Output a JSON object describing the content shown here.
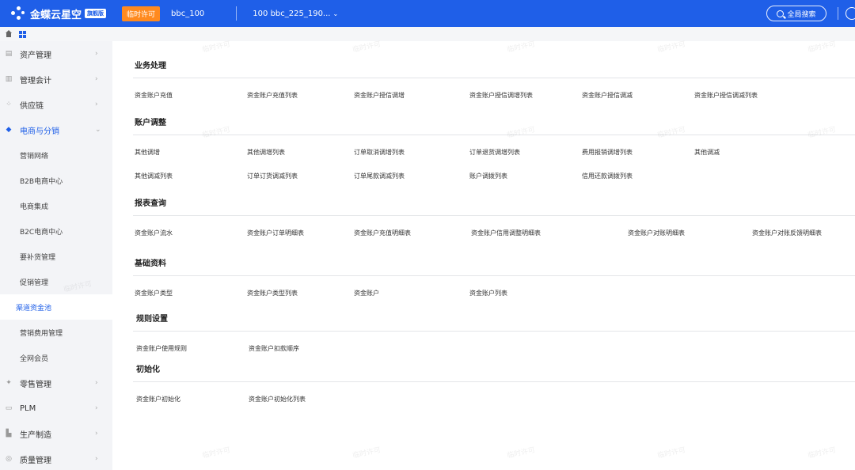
{
  "topbar": {
    "app_name": "金蝶云星空",
    "badge": "旗舰版",
    "license_tag": "临时许可",
    "tenant": "bbc_100",
    "org": "100 bbc_225_190...",
    "search_label": "全局搜索"
  },
  "sidebar": {
    "items": [
      {
        "label": "资产管理",
        "icon": "asset-icon"
      },
      {
        "label": "管理会计",
        "icon": "accounting-icon"
      },
      {
        "label": "供应链",
        "icon": "supply-chain-icon"
      },
      {
        "label": "电商与分销",
        "icon": "ecommerce-icon",
        "open": true
      }
    ],
    "sub_items": [
      {
        "label": "营销网络"
      },
      {
        "label": "B2B电商中心"
      },
      {
        "label": "电商集成"
      },
      {
        "label": "B2C电商中心"
      },
      {
        "label": "要补货管理"
      },
      {
        "label": "促销管理"
      },
      {
        "label": "渠道资金池",
        "active": true
      },
      {
        "label": "营销费用管理"
      },
      {
        "label": "全网会员"
      }
    ],
    "items_after": [
      {
        "label": "零售管理",
        "icon": "retail-icon"
      },
      {
        "label": "PLM",
        "icon": "plm-icon"
      },
      {
        "label": "生产制造",
        "icon": "manufacturing-icon"
      },
      {
        "label": "质量管理",
        "icon": "quality-icon"
      }
    ]
  },
  "sections": [
    {
      "title": "业务处理",
      "rows": [
        [
          "资金账户充值",
          "资金账户充值列表",
          "资金账户授信调增",
          "资金账户授信调增列表",
          "资金账户授信调减",
          "资金账户授信调减列表"
        ]
      ]
    },
    {
      "title": "账户调整",
      "rows": [
        [
          "其他调增",
          "其他调增列表",
          "订单取消调增列表",
          "订单退货调增列表",
          "费用报销调增列表",
          "其他调减"
        ],
        [
          "其他调减列表",
          "订单订货调减列表",
          "订单尾款调减列表",
          "账户调拨列表",
          "信用还款调拨列表"
        ]
      ]
    },
    {
      "title": "报表查询",
      "rows": [
        [
          "资金账户流水",
          "资金账户订单明细表",
          "资金账户充值明细表",
          "资金账户信用调整明细表",
          "资金账户对账明细表",
          "资金账户对账反馈明细表"
        ]
      ]
    },
    {
      "title": "基础资料",
      "rows": [
        [
          "资金账户类型",
          "资金账户类型列表",
          "资金账户",
          "资金账户列表"
        ]
      ]
    },
    {
      "title": "规则设置",
      "rows": [
        [
          "资金账户使用规则",
          "资金账户扣款顺序"
        ]
      ]
    },
    {
      "title": "初始化",
      "rows": [
        [
          "资金账户初始化",
          "资金账户初始化列表"
        ]
      ]
    }
  ],
  "watermark": "临时许可"
}
